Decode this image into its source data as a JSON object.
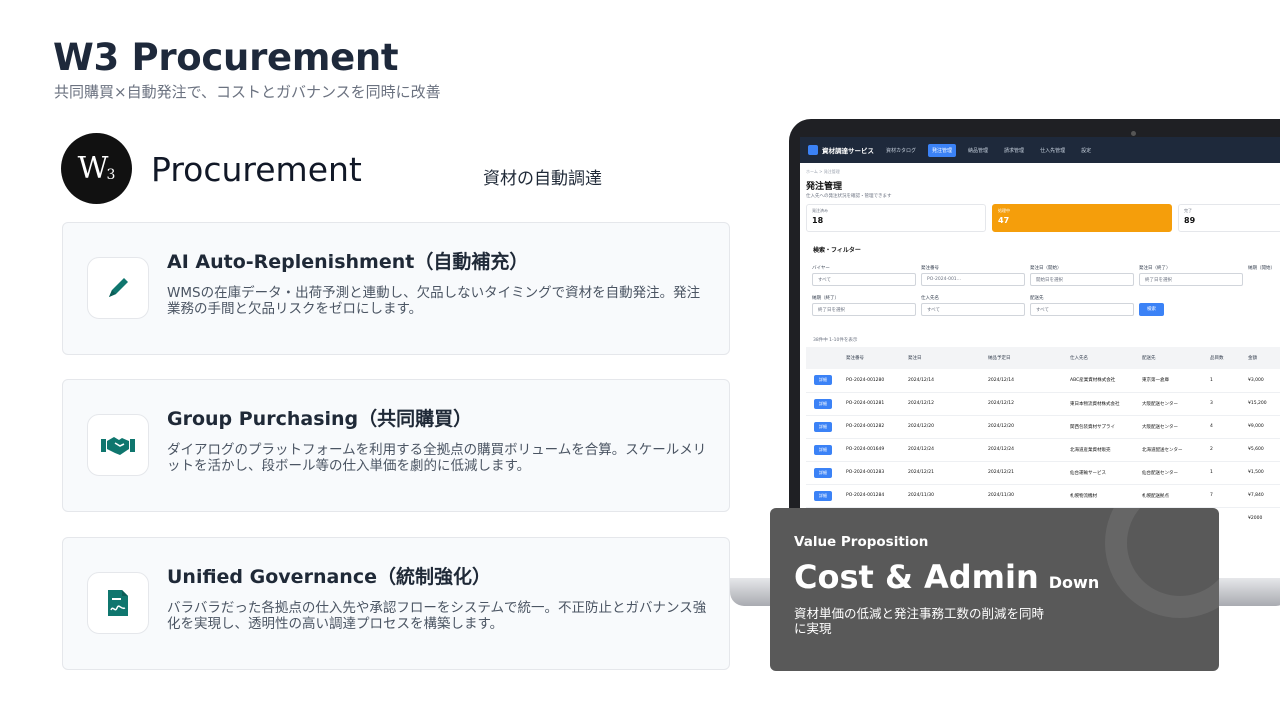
{
  "header": {
    "title": "W3 Procurement",
    "subtitle": "共同購買×自動発注で、コストとガバナンスを同時に改善"
  },
  "brand": {
    "logo_text": "W",
    "logo_sub": "3",
    "name": "Procurement",
    "tagline": "資材の自動調達"
  },
  "features": [
    {
      "title": "AI Auto-Replenishment（自動補充）",
      "desc": "WMSの在庫データ・出荷予測と連動し、欠品しないタイミングで資材を自動発注。発注業務の手間と欠品リスクをゼロにします。",
      "icon": "pencil-icon"
    },
    {
      "title": "Group Purchasing（共同購買）",
      "desc": "ダイアログのプラットフォームを利用する全拠点の購買ボリュームを合算。スケールメリットを活かし、段ボール等の仕入単価を劇的に低減します。",
      "icon": "handshake-icon"
    },
    {
      "title": "Unified Governance（統制強化）",
      "desc": "バラバラだった各拠点の仕入先や承認フローをシステムで統一。不正防止とガバナンス強化を実現し、透明性の高い調達プロセスを構築します。",
      "icon": "contract-icon"
    }
  ],
  "screen": {
    "app_name": "資材調達サービス",
    "nav": [
      "資材カタログ",
      "発注管理",
      "納品管理",
      "請求管理",
      "仕入先管理",
      "設定"
    ],
    "breadcrumb": "ホーム  >  発注管理",
    "page_title": "発注管理",
    "page_sub": "仕入先への発注状況を確認・管理できます",
    "stats": [
      {
        "label": "発注済み",
        "value": "18"
      },
      {
        "label": "処理中",
        "value": "47"
      },
      {
        "label": "完了",
        "value": "89"
      }
    ],
    "filter_title": "検索・フィルター",
    "filters": {
      "buyer_label": "バイヤー",
      "buyer_value": "すべて",
      "po_label": "発注番号",
      "po_placeholder": "PO-2024-001...",
      "start_label": "発注日（開始）",
      "start_placeholder": "開始日を選択",
      "end_label": "発注日（終了）",
      "end_placeholder": "終了日を選択",
      "delivery_label": "納期（開始）",
      "delivery_end_label": "納期（終了）",
      "delivery_end_placeholder": "終了日を選択",
      "supplier_label": "仕入先名",
      "supplier_value": "すべて",
      "ship_label": "配送先",
      "ship_value": "すべて",
      "search_button": "検索"
    },
    "count_text": "38件中 1-10件を表示",
    "columns": [
      "",
      "発注番号",
      "発注日",
      "納品予定日",
      "仕入先名",
      "配送先",
      "品目数",
      "金額"
    ],
    "rows": [
      {
        "btn": "詳細",
        "po": "PO-2024-001280",
        "date": "2024/12/14",
        "due": "2024/12/14",
        "supplier": "ABC産業資材株式会社",
        "dest": "東京第一倉庫",
        "items": "1",
        "amount": "¥3,000"
      },
      {
        "btn": "詳細",
        "po": "PO-2024-001281",
        "date": "2024/12/12",
        "due": "2024/12/12",
        "supplier": "東日本物流資材株式会社",
        "dest": "大阪配送センター",
        "items": "3",
        "amount": "¥15,200"
      },
      {
        "btn": "詳細",
        "po": "PO-2024-001282",
        "date": "2024/12/20",
        "due": "2024/12/20",
        "supplier": "関西包装資材サプライ",
        "dest": "大阪配送センター",
        "items": "4",
        "amount": "¥9,000"
      },
      {
        "btn": "詳細",
        "po": "PO-2024-001649",
        "date": "2024/12/24",
        "due": "2024/12/24",
        "supplier": "北海道産業資材販売",
        "dest": "北海道配送センター",
        "items": "2",
        "amount": "¥5,600"
      },
      {
        "btn": "詳細",
        "po": "PO-2024-001283",
        "date": "2024/12/21",
        "due": "2024/12/21",
        "supplier": "仙台運輸サービス",
        "dest": "仙台配送センター",
        "items": "1",
        "amount": "¥1,500"
      },
      {
        "btn": "詳細",
        "po": "PO-2024-001284",
        "date": "2024/11/30",
        "due": "2024/11/30",
        "supplier": "札幌物流機材",
        "dest": "札幌配送拠点",
        "items": "7",
        "amount": "¥7,840"
      },
      {
        "btn": "詳細",
        "po": "",
        "date": "",
        "due": "",
        "supplier": "",
        "dest": "",
        "items": "",
        "amount": "¥2000"
      }
    ]
  },
  "value_prop": {
    "kicker": "Value Proposition",
    "headline": "Cost & Admin",
    "headline_suffix": "Down",
    "desc": " 資材単価の低減と発注事務工数の削減を同時に実現"
  }
}
